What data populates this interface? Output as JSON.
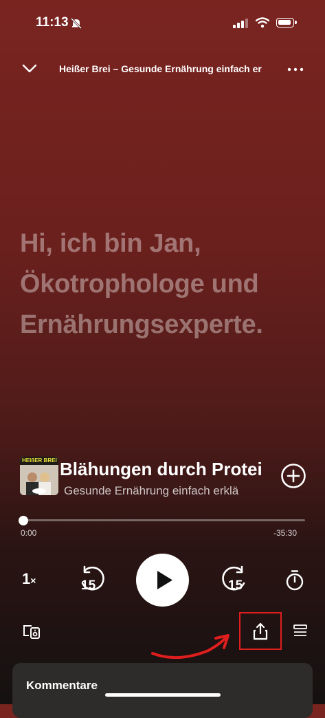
{
  "status": {
    "time": "11:13"
  },
  "header": {
    "title": "Heißer Brei – Gesunde Ernährung einfach er"
  },
  "lyrics": {
    "text": "Hi, ich bin Jan, Ökotrophologe und Ernährungsexperte."
  },
  "episode": {
    "title": "Blähungen durch Protei",
    "show": "Gesunde Ernährung einfach erklä",
    "art_label": "HEIßER BREI"
  },
  "progress": {
    "elapsed": "0:00",
    "remaining": "-35:30",
    "fraction": 0.0
  },
  "controls": {
    "speed": "1",
    "speed_suffix": "×",
    "rewind_seconds": "15",
    "forward_seconds": "15"
  },
  "comments": {
    "label": "Kommentare"
  },
  "colors": {
    "background_top": "#7a2420",
    "highlight_box": "#e01e1e",
    "arrow": "#e01e1e"
  },
  "icons": [
    "mute-bell-icon",
    "signal-icon",
    "wifi-icon",
    "battery-icon",
    "chevron-down-icon",
    "more-icon",
    "add-circle-icon",
    "rewind-15-icon",
    "play-icon",
    "forward-15-icon",
    "sleep-timer-icon",
    "connect-device-icon",
    "share-icon",
    "queue-icon"
  ]
}
